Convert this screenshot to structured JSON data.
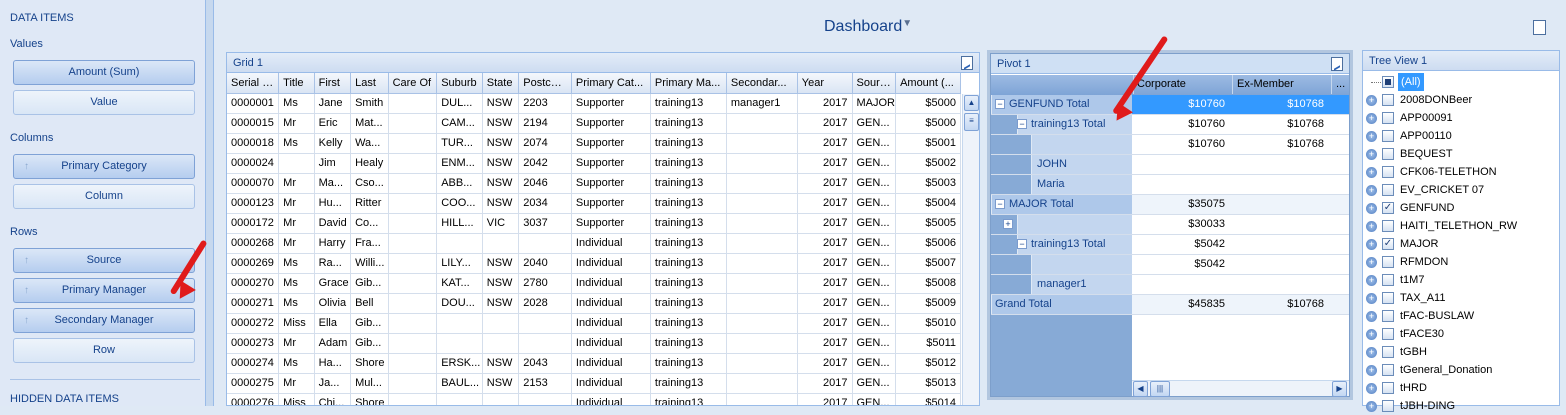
{
  "left_panel": {
    "data_items_label": "DATA ITEMS",
    "values_label": "Values",
    "values_items": [
      "Amount (Sum)",
      "Value"
    ],
    "columns_label": "Columns",
    "columns_items": [
      "Primary Category",
      "Column"
    ],
    "rows_label": "Rows",
    "rows_items": [
      "Source",
      "Primary Manager",
      "Secondary Manager",
      "Row"
    ],
    "hidden_label": "HIDDEN DATA ITEMS"
  },
  "dashboard": {
    "title": "Dashboard"
  },
  "grid": {
    "title": "Grid 1",
    "columns": [
      "Serial No",
      "Title",
      "First",
      "Last",
      "Care Of",
      "Suburb",
      "State",
      "Postcode",
      "Primary Cat...",
      "Primary Ma...",
      "Secondar...",
      "Year",
      "Source",
      "Amount (..."
    ],
    "rows": [
      [
        "0000001",
        "Ms",
        "Jane",
        "Smith",
        "",
        "DUL...",
        "NSW",
        "2203",
        "Supporter",
        "training13",
        "manager1",
        "2017",
        "MAJOR",
        "$5000"
      ],
      [
        "0000015",
        "Mr",
        "Eric",
        "Mat...",
        "",
        "CAM...",
        "NSW",
        "2194",
        "Supporter",
        "training13",
        "",
        "2017",
        "GEN...",
        "$5000"
      ],
      [
        "0000018",
        "Ms",
        "Kelly",
        "Wa...",
        "",
        "TUR...",
        "NSW",
        "2074",
        "Supporter",
        "training13",
        "",
        "2017",
        "GEN...",
        "$5001"
      ],
      [
        "0000024",
        "",
        "Jim",
        "Healy",
        "",
        "ENM...",
        "NSW",
        "2042",
        "Supporter",
        "training13",
        "",
        "2017",
        "GEN...",
        "$5002"
      ],
      [
        "0000070",
        "Mr",
        "Ma...",
        "Cso...",
        "",
        "ABB...",
        "NSW",
        "2046",
        "Supporter",
        "training13",
        "",
        "2017",
        "GEN...",
        "$5003"
      ],
      [
        "0000123",
        "Mr",
        "Hu...",
        "Ritter",
        "",
        "COO...",
        "NSW",
        "2034",
        "Supporter",
        "training13",
        "",
        "2017",
        "GEN...",
        "$5004"
      ],
      [
        "0000172",
        "Mr",
        "David",
        "Co...",
        "",
        "HILL...",
        "VIC",
        "3037",
        "Supporter",
        "training13",
        "",
        "2017",
        "GEN...",
        "$5005"
      ],
      [
        "0000268",
        "Mr",
        "Harry",
        "Fra...",
        "",
        "",
        "",
        "",
        "Individual",
        "training13",
        "",
        "2017",
        "GEN...",
        "$5006"
      ],
      [
        "0000269",
        "Ms",
        "Ra...",
        "Willi...",
        "",
        "LILY...",
        "NSW",
        "2040",
        "Individual",
        "training13",
        "",
        "2017",
        "GEN...",
        "$5007"
      ],
      [
        "0000270",
        "Ms",
        "Grace",
        "Gib...",
        "",
        "KAT...",
        "NSW",
        "2780",
        "Individual",
        "training13",
        "",
        "2017",
        "GEN...",
        "$5008"
      ],
      [
        "0000271",
        "Ms",
        "Olivia",
        "Bell",
        "",
        "DOU...",
        "NSW",
        "2028",
        "Individual",
        "training13",
        "",
        "2017",
        "GEN...",
        "$5009"
      ],
      [
        "0000272",
        "Miss",
        "Ella",
        "Gib...",
        "",
        "",
        "",
        "",
        "Individual",
        "training13",
        "",
        "2017",
        "GEN...",
        "$5010"
      ],
      [
        "0000273",
        "Mr",
        "Adam",
        "Gib...",
        "",
        "",
        "",
        "",
        "Individual",
        "training13",
        "",
        "2017",
        "GEN...",
        "$5011"
      ],
      [
        "0000274",
        "Ms",
        "Ha...",
        "Shore",
        "",
        "ERSK...",
        "NSW",
        "2043",
        "Individual",
        "training13",
        "",
        "2017",
        "GEN...",
        "$5012"
      ],
      [
        "0000275",
        "Mr",
        "Ja...",
        "Mul...",
        "",
        "BAUL...",
        "NSW",
        "2153",
        "Individual",
        "training13",
        "",
        "2017",
        "GEN...",
        "$5013"
      ],
      [
        "0000276",
        "Miss",
        "Chi...",
        "Shore",
        "",
        "",
        "",
        "",
        "Individual",
        "training13",
        "",
        "2017",
        "GEN...",
        "$5014"
      ]
    ]
  },
  "pivot": {
    "title": "Pivot 1",
    "col_headers": [
      "Corporate",
      "Ex-Member",
      "..."
    ],
    "rows": [
      {
        "label": "GENFUND Total",
        "corporate": "$10760",
        "exmember": "$10768"
      },
      {
        "label": "training13 Total",
        "corporate": "$10760",
        "exmember": "$10768"
      },
      {
        "label": "",
        "corporate": "$10760",
        "exmember": "$10768"
      },
      {
        "label": "JOHN",
        "corporate": "",
        "exmember": ""
      },
      {
        "label": "Maria",
        "corporate": "",
        "exmember": ""
      },
      {
        "label": "MAJOR Total",
        "corporate": "$35075",
        "exmember": ""
      },
      {
        "label": "",
        "corporate": "$30033",
        "exmember": ""
      },
      {
        "label": "training13 Total",
        "corporate": "$5042",
        "exmember": ""
      },
      {
        "label": "",
        "corporate": "$5042",
        "exmember": ""
      },
      {
        "label": "manager1",
        "corporate": "",
        "exmember": ""
      },
      {
        "label": "Grand Total",
        "corporate": "$45835",
        "exmember": "$10768"
      }
    ]
  },
  "tree": {
    "title": "Tree View 1",
    "items": [
      {
        "label": "(All)",
        "checked": "indeterminate"
      },
      {
        "label": "2008DONBeer",
        "checked": "no"
      },
      {
        "label": "APP00091",
        "checked": "no"
      },
      {
        "label": "APP00110",
        "checked": "no"
      },
      {
        "label": "BEQUEST",
        "checked": "no"
      },
      {
        "label": "CFK06-TELETHON",
        "checked": "no"
      },
      {
        "label": "EV_CRICKET 07",
        "checked": "no"
      },
      {
        "label": "GENFUND",
        "checked": "yes"
      },
      {
        "label": "HAITI_TELETHON_RW",
        "checked": "no"
      },
      {
        "label": "MAJOR",
        "checked": "yes"
      },
      {
        "label": "RFMDON",
        "checked": "no"
      },
      {
        "label": "t1M7",
        "checked": "no"
      },
      {
        "label": "TAX_A11",
        "checked": "no"
      },
      {
        "label": "tFAC-BUSLAW",
        "checked": "no"
      },
      {
        "label": "tFACE30",
        "checked": "no"
      },
      {
        "label": "tGBH",
        "checked": "no"
      },
      {
        "label": "tGeneral_Donation",
        "checked": "no"
      },
      {
        "label": "tHRD",
        "checked": "no"
      },
      {
        "label": "tJBH-DING",
        "checked": "no"
      }
    ]
  },
  "colors": {
    "accent": "#15428b",
    "arrow": "#e01b1b",
    "selected": "#3399ff"
  }
}
